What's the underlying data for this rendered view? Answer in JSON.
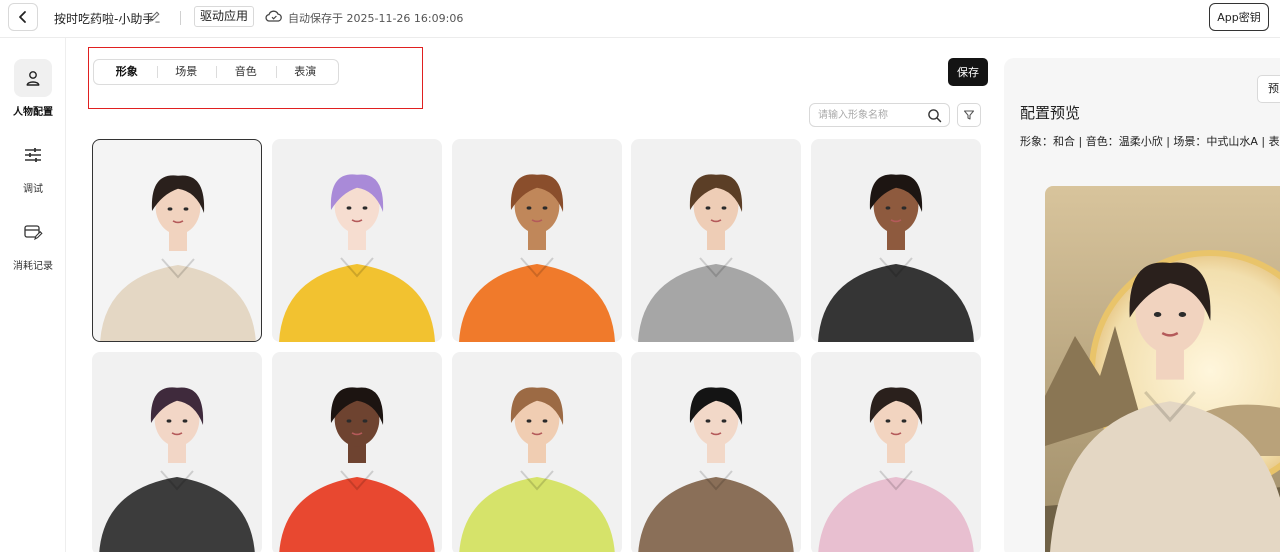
{
  "header": {
    "app_title": "按时吃药啦-小助手",
    "drive_tag": "驱动应用",
    "autosave_text": "自动保存于 2025-11-26 16:09:06",
    "app_key_label": "App密钥"
  },
  "sidebar": {
    "items": [
      {
        "label": "人物配置",
        "icon": "person-icon",
        "active": true
      },
      {
        "label": "调试",
        "icon": "sliders-icon",
        "active": false
      },
      {
        "label": "消耗记录",
        "icon": "card-edit-icon",
        "active": false
      }
    ]
  },
  "tabs": [
    {
      "label": "形象",
      "active": true
    },
    {
      "label": "场景",
      "active": false
    },
    {
      "label": "音色",
      "active": false
    },
    {
      "label": "表演",
      "active": false
    }
  ],
  "toolbar": {
    "save_label": "保存",
    "search_placeholder": "请输入形象名称",
    "search_value": ""
  },
  "avatars": [
    {
      "skin": "#f1d3bf",
      "hair": "#2a201c",
      "top": "#e4d7c4",
      "selected": true
    },
    {
      "skin": "#f6ddd0",
      "hair": "#a98ad8",
      "top": "#f2c230",
      "selected": false
    },
    {
      "skin": "#c0875a",
      "hair": "#8a4e2c",
      "top": "#f07a2b",
      "selected": false
    },
    {
      "skin": "#eecdb6",
      "hair": "#5b3e26",
      "top": "#a6a6a6",
      "selected": false
    },
    {
      "skin": "#8e5a3e",
      "hair": "#1d1512",
      "top": "#353535",
      "selected": false
    },
    {
      "skin": "#f2d6c6",
      "hair": "#3f2a3c",
      "top": "#3c3c3c",
      "selected": false
    },
    {
      "skin": "#6e4330",
      "hair": "#1c1411",
      "top": "#e84830",
      "selected": false
    },
    {
      "skin": "#f0cdb2",
      "hair": "#9c6a44",
      "top": "#d6e36a",
      "selected": false
    },
    {
      "skin": "#f2d8c8",
      "hair": "#141414",
      "top": "#8a6f58",
      "selected": false
    },
    {
      "skin": "#f2d4c0",
      "hair": "#2a201c",
      "top": "#e8bfd0",
      "selected": false
    }
  ],
  "preview": {
    "title": "配置预览",
    "summary": "形象：和合 | 音色：温柔小欣 | 场景：中式山水A | 表",
    "button_label": "预览",
    "avatar": {
      "skin": "#f1d3bf",
      "hair": "#2a201c",
      "top": "#e4d7c4"
    }
  },
  "colors": {
    "accent_dark": "#141414",
    "highlight_red": "#e02020"
  }
}
